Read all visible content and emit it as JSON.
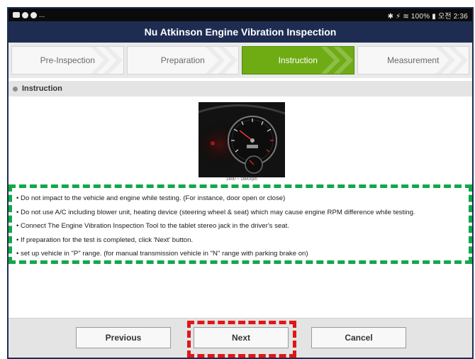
{
  "statusbar": {
    "left_text": "...",
    "right_text": "✱ ⚡ ≋ 100% ▮ 오전 2:36"
  },
  "app": {
    "title": "Nu Atkinson Engine Vibration Inspection"
  },
  "steps": [
    {
      "label": "Pre-Inspection",
      "active": false
    },
    {
      "label": "Preparation",
      "active": false
    },
    {
      "label": "Instruction",
      "active": true
    },
    {
      "label": "Measurement",
      "active": false
    }
  ],
  "section": {
    "title": "Instruction"
  },
  "photo": {
    "caption": "1400 ~ 1600rpm"
  },
  "instructions": [
    "• Do not impact to the vehicle and engine while testing.  (For instance, door open or close)",
    "• Do not use A/C including blower unit, heating   device (steering wheel & seat) which may cause engine RPM difference while testing.",
    "• Connect The Engine Vibration Inspection Tool to the tablet stereo jack in the driver's seat.",
    "• If preparation for the test is completed,  click 'Next' button.",
    "• set up vehicle in \"P\" range. (for manual transmission vehicle in \"N\" range with parking brake on)"
  ],
  "buttons": {
    "previous": "Previous",
    "next": "Next",
    "cancel": "Cancel"
  },
  "colors": {
    "title_bg": "#1f2c52",
    "active_step": "#6fac14",
    "highlight_green": "#12a84a",
    "highlight_red": "#e01616"
  }
}
